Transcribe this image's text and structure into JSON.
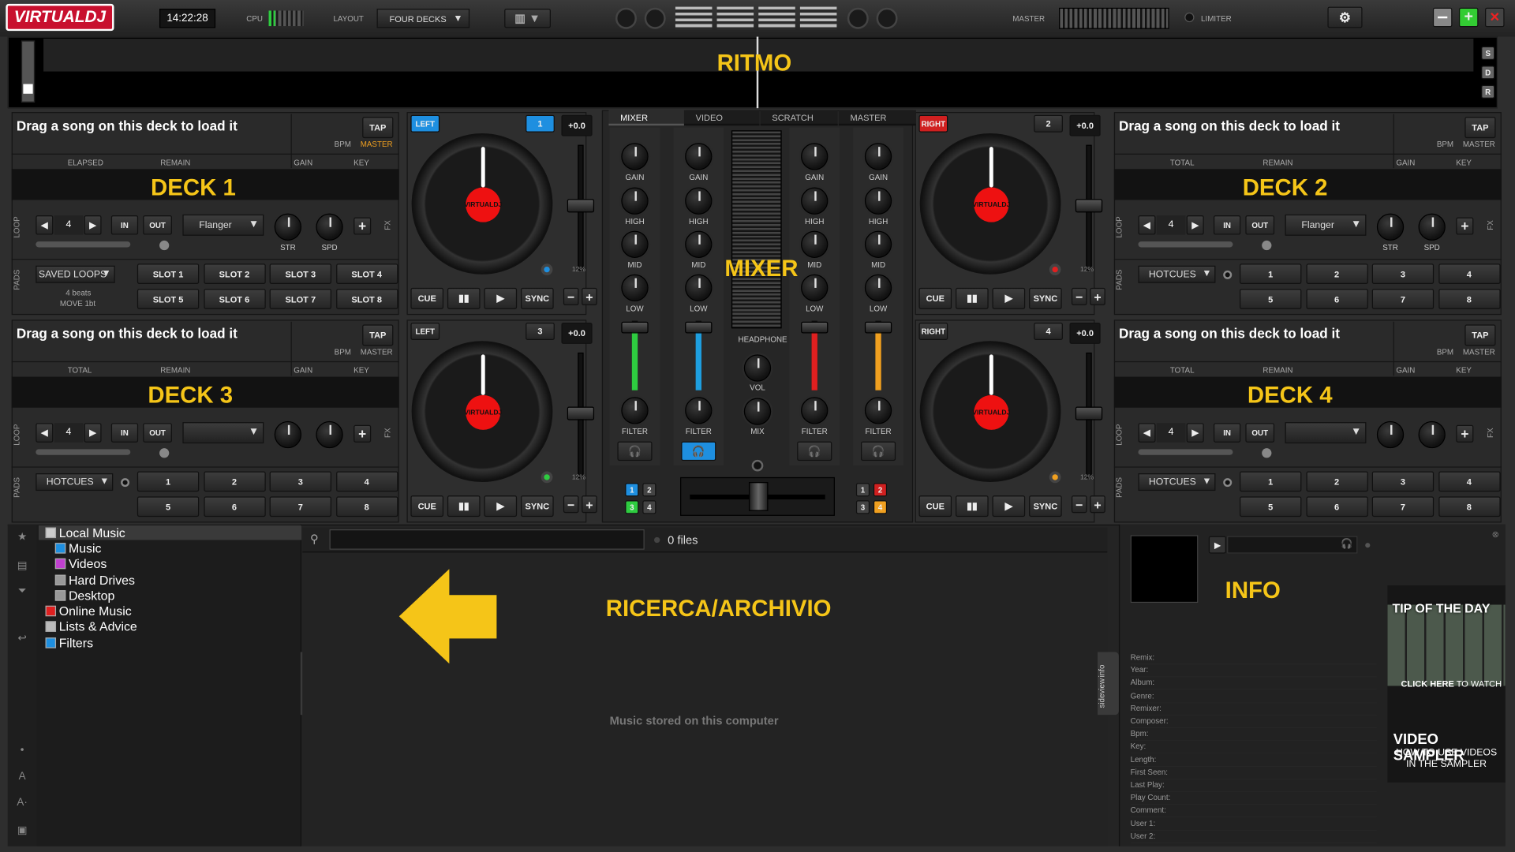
{
  "topbar": {
    "logo": "VIRTUALDJ",
    "clock": "14:22:28",
    "cpu_label": "CPU",
    "layout_label": "LAYOUT",
    "layout_value": "FOUR DECKS",
    "master_label": "MASTER",
    "limiter_label": "LIMITER",
    "minimize_icon": "minimize-icon",
    "maximize_icon": "plus-icon",
    "close_icon": "close-icon",
    "settings_icon": "gear-icon"
  },
  "rhythm": {
    "overlay": "RITMO",
    "side_buttons": [
      "S",
      "D",
      "R"
    ]
  },
  "overlays": {
    "deck1": "DECK 1",
    "deck2": "DECK 2",
    "deck3": "DECK 3",
    "deck4": "DECK 4",
    "mixer": "MIXER",
    "browser": "RICERCA/ARCHIVIO",
    "info": "INFO"
  },
  "decks": [
    {
      "prompt": "Drag a song on this deck to load it",
      "tap": "TAP",
      "bpm": "BPM",
      "master": "MASTER",
      "col1": "ELAPSED",
      "col2": "REMAIN",
      "gain": "GAIN",
      "key": "KEY",
      "loop_side": "LOOP",
      "loop_val": "4",
      "in": "IN",
      "out": "OUT",
      "fx": "Flanger",
      "fx_side": "FX",
      "str": "STR",
      "spd": "SPD",
      "pads_side": "PADS",
      "pad_mode": "SAVED LOOPS",
      "pad_info1": "4 beats",
      "pad_info2": "MOVE 1bt",
      "pads": [
        "SLOT 1",
        "SLOT 2",
        "SLOT 3",
        "SLOT 4",
        "SLOT 5",
        "SLOT 6",
        "SLOT 7",
        "SLOT 8"
      ],
      "side": "LEFT",
      "num": "1",
      "pitch": "+0.0",
      "pitch_range": "12%",
      "cue": "CUE",
      "sync": "SYNC"
    },
    {
      "prompt": "Drag a song on this deck to load it",
      "tap": "TAP",
      "bpm": "BPM",
      "master": "MASTER",
      "col1": "TOTAL",
      "col2": "REMAIN",
      "gain": "GAIN",
      "key": "KEY",
      "loop_side": "LOOP",
      "loop_val": "4",
      "in": "IN",
      "out": "OUT",
      "fx": "Flanger",
      "fx_side": "FX",
      "str": "STR",
      "spd": "SPD",
      "pads_side": "PADS",
      "pad_mode": "HOTCUES",
      "pads": [
        "1",
        "2",
        "3",
        "4",
        "5",
        "6",
        "7",
        "8"
      ],
      "side": "RIGHT",
      "num": "2",
      "pitch": "+0.0",
      "pitch_range": "12%",
      "cue": "CUE",
      "sync": "SYNC"
    },
    {
      "prompt": "Drag a song on this deck to load it",
      "tap": "TAP",
      "bpm": "BPM",
      "master": "MASTER",
      "col1": "TOTAL",
      "col2": "REMAIN",
      "gain": "GAIN",
      "key": "KEY",
      "loop_side": "LOOP",
      "loop_val": "4",
      "in": "IN",
      "out": "OUT",
      "fx": "",
      "fx_side": "FX",
      "pads_side": "PADS",
      "pad_mode": "HOTCUES",
      "pads": [
        "1",
        "2",
        "3",
        "4",
        "5",
        "6",
        "7",
        "8"
      ],
      "side": "LEFT",
      "num": "3",
      "pitch": "+0.0",
      "pitch_range": "12%",
      "cue": "CUE",
      "sync": "SYNC"
    },
    {
      "prompt": "Drag a song on this deck to load it",
      "tap": "TAP",
      "bpm": "BPM",
      "master": "MASTER",
      "col1": "TOTAL",
      "col2": "REMAIN",
      "gain": "GAIN",
      "key": "KEY",
      "loop_side": "LOOP",
      "loop_val": "4",
      "in": "IN",
      "out": "OUT",
      "fx": "",
      "fx_side": "FX",
      "pads_side": "PADS",
      "pad_mode": "HOTCUES",
      "pads": [
        "1",
        "2",
        "3",
        "4",
        "5",
        "6",
        "7",
        "8"
      ],
      "side": "RIGHT",
      "num": "4",
      "pitch": "+0.0",
      "pitch_range": "12%",
      "cue": "CUE",
      "sync": "SYNC"
    }
  ],
  "mixer": {
    "tabs": [
      "MIXER",
      "VIDEO",
      "SCRATCH",
      "MASTER"
    ],
    "gain": "GAIN",
    "high": "HIGH",
    "mid": "MID",
    "low": "LOW",
    "filter": "FILTER",
    "headphone": "HEADPHONE",
    "vol": "VOL",
    "mix": "MIX",
    "channel_colors": [
      "#2ecc40",
      "#1e9fe0",
      "#e02020",
      "#f0a020"
    ],
    "left_nums": [
      "1",
      "2",
      "3",
      "4"
    ],
    "right_nums": [
      "1",
      "2",
      "3",
      "4"
    ]
  },
  "browser": {
    "tree": [
      {
        "label": "Local Music",
        "color": "#cccccc"
      },
      {
        "label": "Music",
        "color": "#1e8fe0"
      },
      {
        "label": "Videos",
        "color": "#c040d0"
      },
      {
        "label": "Hard Drives",
        "color": "#999999"
      },
      {
        "label": "Desktop",
        "color": "#999999"
      },
      {
        "label": "Online Music",
        "color": "#e02020"
      },
      {
        "label": "Lists & Advice",
        "color": "#bbbbbb"
      },
      {
        "label": "Filters",
        "color": "#1e8fe0"
      }
    ],
    "search_placeholder": "",
    "files": "0 files",
    "empty_msg": "Music stored on this computer",
    "folders_tab": "folders",
    "sideview_tab": "sideview",
    "info_tab": "info",
    "left_icons": [
      "star-icon",
      "sampler-icon",
      "filter-icon",
      "back-icon",
      "dot-icon",
      "font-a-icon",
      "font-a-minus-icon",
      "layout-icon"
    ],
    "a1": "A",
    "a2": "A-"
  },
  "info": {
    "fields": [
      "Remix:",
      "Year:",
      "Album:",
      "Genre:",
      "Remixer:",
      "Composer:",
      "Bpm:",
      "Key:",
      "Length:",
      "First Seen:",
      "Last Play:",
      "Play Count:",
      "Comment:",
      "User 1:",
      "User 2:"
    ],
    "tip_title": "TIP OF THE DAY",
    "tip_click_a": "CLICK HERE",
    "tip_click_b": "TO WATCH",
    "tip_head": "VIDEO SAMPLER",
    "tip_sub1": "HOW TO USE VIDEOS",
    "tip_sub2": "IN THE SAMPLER"
  }
}
